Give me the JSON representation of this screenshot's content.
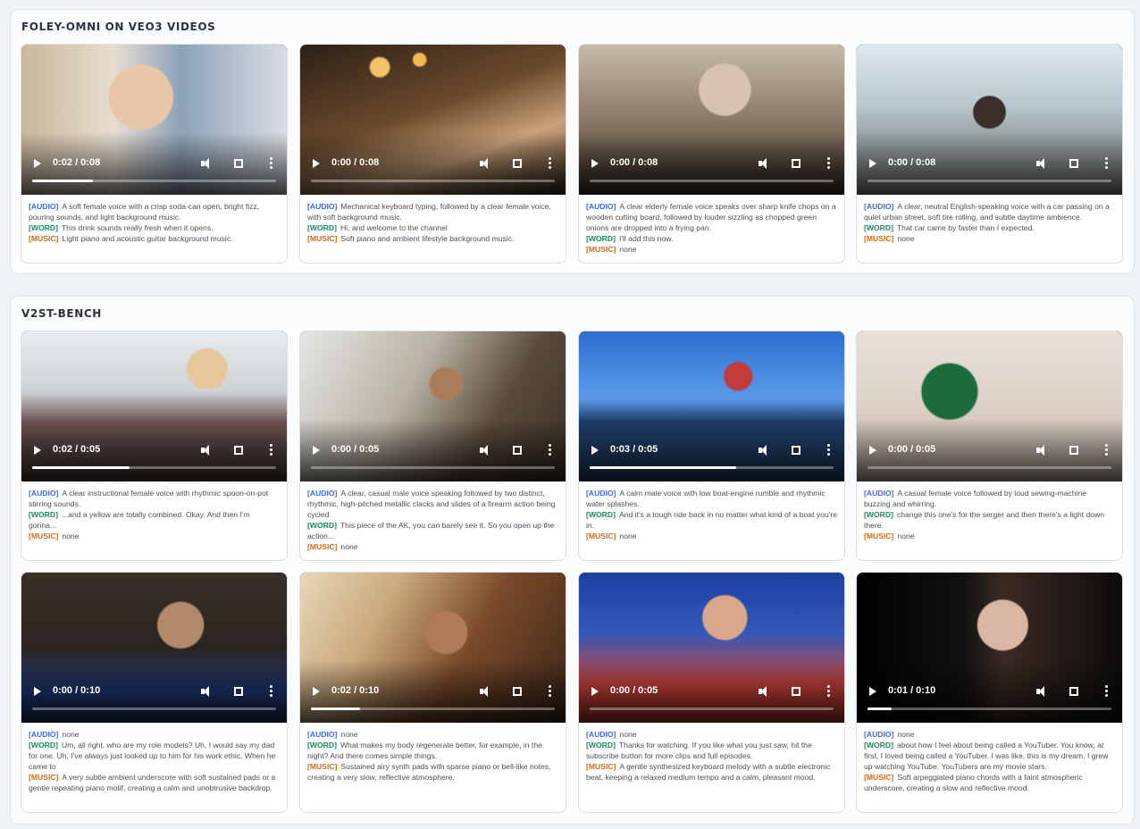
{
  "sections": [
    {
      "title": "FOLEY-OMNI ON VEO3 VIDEOS",
      "cards": [
        {
          "time": "0:02 / 0:08",
          "progress": 0.25,
          "audio": "A soft female voice with a crisp soda-can open, bright fizz, pouring sounds, and light background music.",
          "word": "This drink sounds really fresh when it opens.",
          "music": "Light piano and acoustic guitar background music."
        },
        {
          "time": "0:00 / 0:08",
          "progress": 0.0,
          "audio": "Mechanical keyboard typing, followed by a clear female voice, with soft background music.",
          "word": "Hi, and welcome to the channel",
          "music": "Soft piano and ambient lifestyle background music."
        },
        {
          "time": "0:00 / 0:08",
          "progress": 0.0,
          "audio": "A clear elderly female voice speaks over sharp knife chops on a wooden cutting board, followed by louder sizzling as chopped green onions are dropped into a frying pan.",
          "word": "I'll add this now.",
          "music": "none"
        },
        {
          "time": "0:00 / 0:08",
          "progress": 0.0,
          "audio": "A clear, neutral English-speaking voice with a car passing on a quiet urban street, soft tire rolling, and subtle daytime ambience.",
          "word": "That car came by faster than I expected.",
          "music": "none"
        }
      ]
    },
    {
      "title": "V2ST-BENCH",
      "cards": [
        {
          "time": "0:02 / 0:05",
          "progress": 0.4,
          "audio": "A clear instructional female voice with rhythmic spoon-on-pot stirring sounds.",
          "word": "...and a yellow are totally combined. Okay. And then I'm gonna...",
          "music": "none"
        },
        {
          "time": "0:00 / 0:05",
          "progress": 0.0,
          "audio": "A clear, casual male voice speaking followed by two distinct, rhythmic, high-pitched metallic clacks and slides of a firearm action being cycled.",
          "word": "This piece of the AK, you can barely see it. So you open up the action...",
          "music": "none"
        },
        {
          "time": "0:03 / 0:05",
          "progress": 0.6,
          "audio": "A calm male voice with low boat-engine rumble and rhythmic water splashes.",
          "word": "And it's a tough ride back in no matter what kind of a boat you're in.",
          "music": "none"
        },
        {
          "time": "0:00 / 0:05",
          "progress": 0.0,
          "audio": "A casual female voice followed by loud sewing-machine buzzing and whirring.",
          "word": "change this one's for the serger and then there's a light down there.",
          "music": "none"
        },
        {
          "time": "0:00 / 0:10",
          "progress": 0.0,
          "audio": "none",
          "word": "Um, all right, who are my role models? Uh, I would say my dad for one. Uh, I've always just looked up to him for his work ethic. When he came to",
          "music": "A very subtle ambient underscore with soft sustained pads or a gentle repeating piano motif, creating a calm and unobtrusive backdrop."
        },
        {
          "time": "0:02 / 0:10",
          "progress": 0.2,
          "audio": "none",
          "word": "What makes my body regenerate better, for example, in the night? And there comes simple things.",
          "music": "Sustained airy synth pads with sparse piano or bell-like notes, creating a very slow, reflective atmosphere."
        },
        {
          "time": "0:00 / 0:05",
          "progress": 0.0,
          "audio": "none",
          "word": "Thanks for watching. If you like what you just saw, hit the subscribe button for more clips and full episodes.",
          "music": "A gentle synthesized keyboard melody with a subtle electronic beat, keeping a relaxed medium tempo and a calm, pleasant mood."
        },
        {
          "time": "0:01 / 0:10",
          "progress": 0.1,
          "audio": "none",
          "word": "about how I feel about being called a YouTuber. You know, at first, I loved being called a YouTuber. I was like, this is my dream. I grew up watching YouTube. YouTubers are my movie stars.",
          "music": "Soft arpeggiated piano chords with a faint atmospheric underscore, creating a slow and reflective mood."
        }
      ]
    }
  ],
  "labels": {
    "audio": "[AUDIO]",
    "word": "[WORD]",
    "music": "[MUSIC]"
  },
  "colors": {
    "audio": "#3f6ad8",
    "word": "#198a5c",
    "music": "#d46a12"
  }
}
